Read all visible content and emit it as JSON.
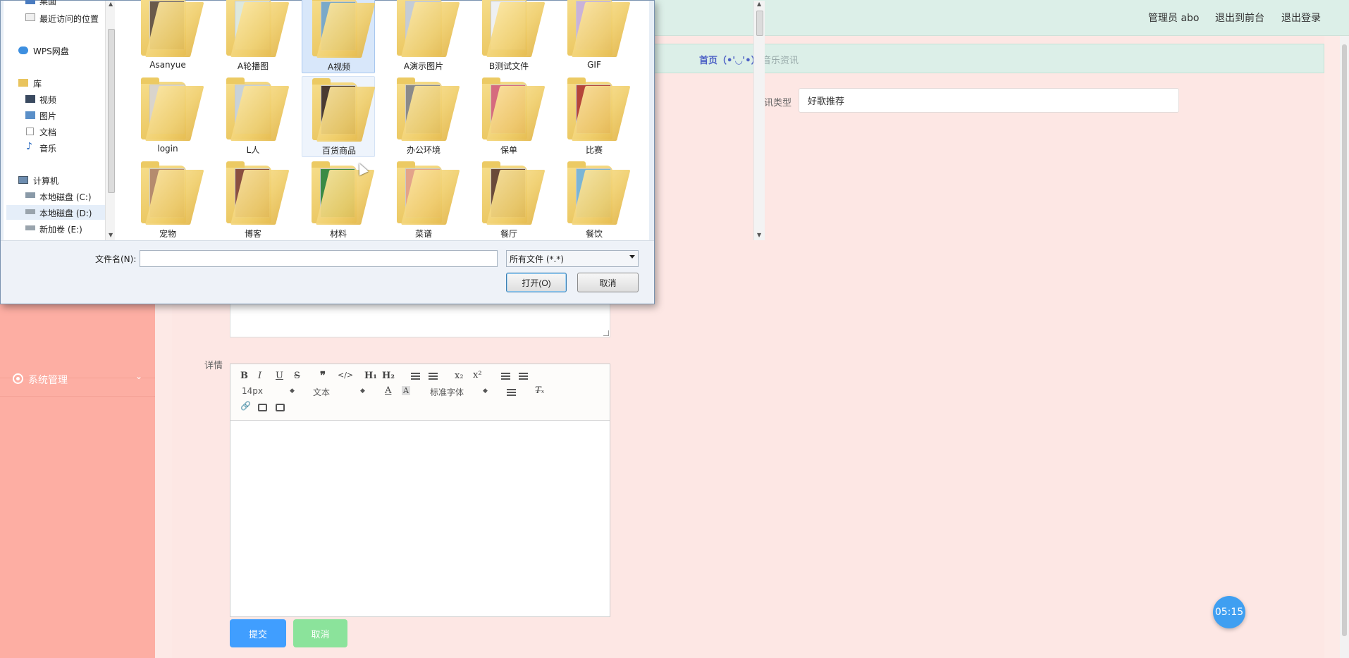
{
  "topbar": {
    "admin_label": "管理员 abo",
    "to_front_label": "退出到前台",
    "logout_label": "退出登录"
  },
  "breadcrumb": {
    "home": "首页（•'◡'•）",
    "current": "音乐资讯"
  },
  "sidebar": {
    "items": [
      {
        "label": "系统管理",
        "icon": "gear-icon"
      }
    ]
  },
  "form": {
    "type_label": "资讯类型",
    "type_value": "好歌推荐",
    "detail_label": "详情",
    "submit_label": "提交",
    "cancel_label": "取消"
  },
  "editor": {
    "font_size": "14px",
    "block_format": "文本",
    "font_family": "标准字体"
  },
  "timer": "05:15",
  "dialog": {
    "nav": {
      "items": [
        {
          "label": "桌面"
        },
        {
          "label": "最近访问的位置"
        },
        {
          "label": "WPS网盘"
        },
        {
          "label": "库"
        },
        {
          "label": "视频"
        },
        {
          "label": "图片"
        },
        {
          "label": "文档"
        },
        {
          "label": "音乐"
        },
        {
          "label": "计算机"
        },
        {
          "label": "本地磁盘 (C:)"
        },
        {
          "label": "本地磁盘 (D:)"
        },
        {
          "label": "新加卷 (E:)"
        }
      ]
    },
    "folders": [
      {
        "name": "Asanyue"
      },
      {
        "name": "A轮播图"
      },
      {
        "name": "A视频"
      },
      {
        "name": "A演示图片"
      },
      {
        "name": "B测试文件"
      },
      {
        "name": "GIF"
      },
      {
        "name": "login"
      },
      {
        "name": "L人"
      },
      {
        "name": "百货商品"
      },
      {
        "name": "办公环境"
      },
      {
        "name": "保单"
      },
      {
        "name": "比赛"
      },
      {
        "name": "宠物"
      },
      {
        "name": "博客"
      },
      {
        "name": "材料"
      },
      {
        "name": "菜谱"
      },
      {
        "name": "餐厅"
      },
      {
        "name": "餐饮"
      }
    ],
    "filename_label": "文件名(N):",
    "filename_value": "",
    "filetype_value": "所有文件 (*.*)",
    "open_label": "打开(O)",
    "cancel_label": "取消"
  },
  "colors": {
    "accent_blue": "#409eff",
    "cancel_green": "#8be39b",
    "sidebar": "#fdaea3",
    "header": "#dcefe8"
  }
}
